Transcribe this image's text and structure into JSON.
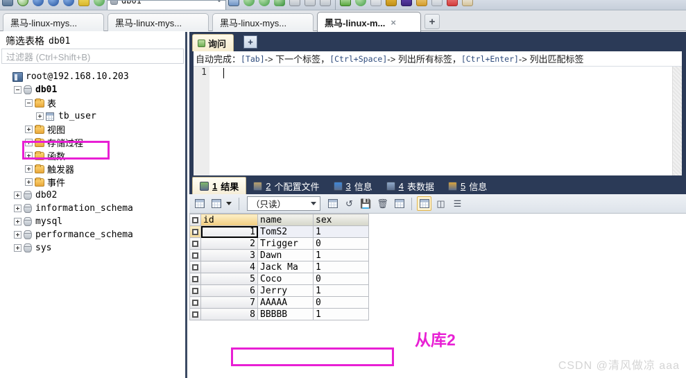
{
  "toolbar": {
    "db_combo_value": "db01",
    "icons": [
      "connect-icon",
      "new-connection-icon",
      "refresh-icon",
      "back-icon",
      "forward-icon",
      "sql-run-icon",
      "export-icon",
      "import-icon",
      "sync-icon",
      "table-designer-icon",
      "grid-icon",
      "report-icon",
      "check-icon",
      "db-icon",
      "grant-icon",
      "backup-icon",
      "query-icon",
      "user-icon",
      "console-icon",
      "calendar-icon",
      "diagram-icon"
    ]
  },
  "window_tabs": {
    "items": [
      {
        "label": "黑马-linux-mys...",
        "active": false
      },
      {
        "label": "黑马-linux-mys...",
        "active": false
      },
      {
        "label": "黑马-linux-mys...",
        "active": false
      },
      {
        "label": "黑马-linux-m...",
        "active": true
      }
    ],
    "close_glyph": "×",
    "new_tab_label": "+"
  },
  "left_panel": {
    "title_prefix": "筛选表格",
    "title_db": "db01",
    "filter_placeholder": "过滤器 (Ctrl+Shift+B)",
    "tree": [
      {
        "indent": 0,
        "toggle": "none",
        "icon": "server-icon",
        "label": "root@192.168.10.203",
        "bold": false,
        "cjk": false
      },
      {
        "indent": 1,
        "toggle": "minus",
        "icon": "database-icon",
        "label": "db01",
        "bold": true,
        "cjk": false
      },
      {
        "indent": 2,
        "toggle": "minus",
        "icon": "folder-icon",
        "label": "表",
        "bold": false,
        "cjk": true
      },
      {
        "indent": 3,
        "toggle": "plus",
        "icon": "table-icon",
        "label": "tb_user",
        "bold": false,
        "cjk": false
      },
      {
        "indent": 2,
        "toggle": "plus",
        "icon": "folder-icon",
        "label": "视图",
        "bold": false,
        "cjk": true
      },
      {
        "indent": 2,
        "toggle": "plus",
        "icon": "folder-icon",
        "label": "存储过程",
        "bold": false,
        "cjk": true
      },
      {
        "indent": 2,
        "toggle": "plus",
        "icon": "folder-icon",
        "label": "函数",
        "bold": false,
        "cjk": true
      },
      {
        "indent": 2,
        "toggle": "plus",
        "icon": "folder-icon",
        "label": "触发器",
        "bold": false,
        "cjk": true
      },
      {
        "indent": 2,
        "toggle": "plus",
        "icon": "folder-icon",
        "label": "事件",
        "bold": false,
        "cjk": true
      },
      {
        "indent": 1,
        "toggle": "plus",
        "icon": "database-icon",
        "label": "db02",
        "bold": false,
        "cjk": false
      },
      {
        "indent": 1,
        "toggle": "plus",
        "icon": "database-icon",
        "label": "information_schema",
        "bold": false,
        "cjk": false
      },
      {
        "indent": 1,
        "toggle": "plus",
        "icon": "database-icon",
        "label": "mysql",
        "bold": false,
        "cjk": false
      },
      {
        "indent": 1,
        "toggle": "plus",
        "icon": "database-icon",
        "label": "performance_schema",
        "bold": false,
        "cjk": false
      },
      {
        "indent": 1,
        "toggle": "plus",
        "icon": "database-icon",
        "label": "sys",
        "bold": false,
        "cjk": false
      }
    ]
  },
  "query_tabs": {
    "active_label": "询问",
    "new_label": "+"
  },
  "editor": {
    "hint_prefix": "自动完成：",
    "hint_key1": "[Tab]",
    "hint_text1": "-> 下一个标签，",
    "hint_key2": "[Ctrl+Space]",
    "hint_text2": "-> 列出所有标签，",
    "hint_key3": "[Ctrl+Enter]",
    "hint_text3": "-> 列出匹配标签",
    "line_number": "1",
    "code": ""
  },
  "result_tabs": [
    {
      "num": "1",
      "label": "结果",
      "icon": "result-grid-icon",
      "active": true
    },
    {
      "num": "2",
      "label": "个配置文件",
      "icon": "profile-icon",
      "active": false
    },
    {
      "num": "3",
      "label": "信息",
      "icon": "info-icon",
      "active": false
    },
    {
      "num": "4",
      "label": "表数据",
      "icon": "table-data-icon",
      "active": false
    },
    {
      "num": "5",
      "label": "信息",
      "icon": "status-icon",
      "active": false
    }
  ],
  "grid_toolbar": {
    "mode_value": "（只读）",
    "buttons": [
      "grid-insert-icon",
      "grid-export-icon",
      "dropdown-arrow",
      "insert-row-icon",
      "duplicate-row-icon",
      "save-icon",
      "delete-row-icon",
      "cancel-edit-icon",
      "view-grid-icon",
      "view-form-icon",
      "view-text-icon"
    ]
  },
  "grid": {
    "columns": [
      "id",
      "name",
      "sex"
    ],
    "rows": [
      {
        "id": "1",
        "name": "TomS2",
        "sex": "1"
      },
      {
        "id": "2",
        "name": "Trigger",
        "sex": "0"
      },
      {
        "id": "3",
        "name": "Dawn",
        "sex": "1"
      },
      {
        "id": "4",
        "name": "Jack Ma",
        "sex": "1"
      },
      {
        "id": "5",
        "name": "Coco",
        "sex": "0"
      },
      {
        "id": "6",
        "name": "Jerry",
        "sex": "1"
      },
      {
        "id": "7",
        "name": "AAAAA",
        "sex": "0"
      },
      {
        "id": "8",
        "name": "BBBBB",
        "sex": "1"
      }
    ]
  },
  "annotations": {
    "slave_label": "从库2",
    "highlight_color": "#e81fd4"
  },
  "watermark": "CSDN @清风做凉 aaa"
}
